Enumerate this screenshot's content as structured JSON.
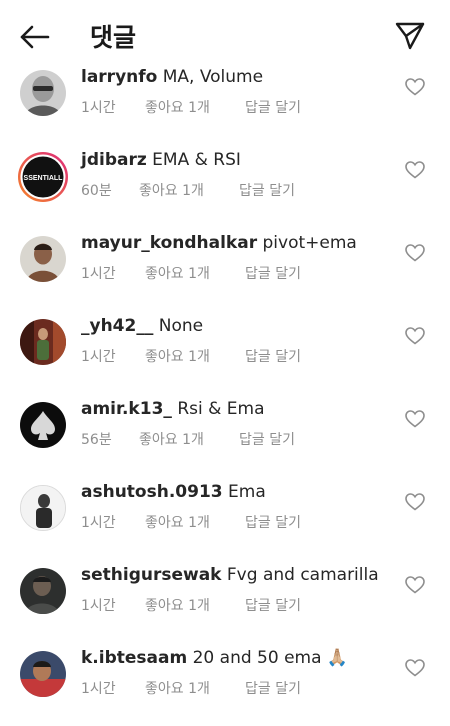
{
  "header": {
    "title": "댓글"
  },
  "comments": [
    {
      "username": "larrynfo",
      "text": "MA, Volume",
      "time": "1시간",
      "likes": "좋아요 1개",
      "reply": "답글 달기"
    },
    {
      "username": "jdibarz",
      "text": "EMA & RSI",
      "time": "60분",
      "likes": "좋아요 1개",
      "reply": "답글 달기"
    },
    {
      "username": "mayur_kondhalkar",
      "text": "pivot+ema",
      "time": "1시간",
      "likes": "좋아요 1개",
      "reply": "답글 달기"
    },
    {
      "username": "_yh42__",
      "text": "None",
      "time": "1시간",
      "likes": "좋아요 1개",
      "reply": "답글 달기"
    },
    {
      "username": "amir.k13_",
      "text": "Rsi & Ema",
      "time": "56분",
      "likes": "좋아요 1개",
      "reply": "답글 달기"
    },
    {
      "username": "ashutosh.0913",
      "text": "Ema",
      "time": "1시간",
      "likes": "좋아요 1개",
      "reply": "답글 달기"
    },
    {
      "username": "sethigursewak",
      "text": "Fvg and camarilla",
      "time": "1시간",
      "likes": "좋아요 1개",
      "reply": "답글 달기"
    },
    {
      "username": "k.ibtesaam",
      "text": "20 and 50 ema 🙏🏼",
      "time": "1시간",
      "likes": "좋아요 1개",
      "reply": "답글 달기"
    }
  ],
  "avatar_texts": {
    "jdibarz": "SSENTIALL"
  },
  "colors": {
    "text": "#262626",
    "meta": "#8e8e8e",
    "story_ring_start": "#f58529",
    "story_ring_end": "#dd2a7b"
  }
}
